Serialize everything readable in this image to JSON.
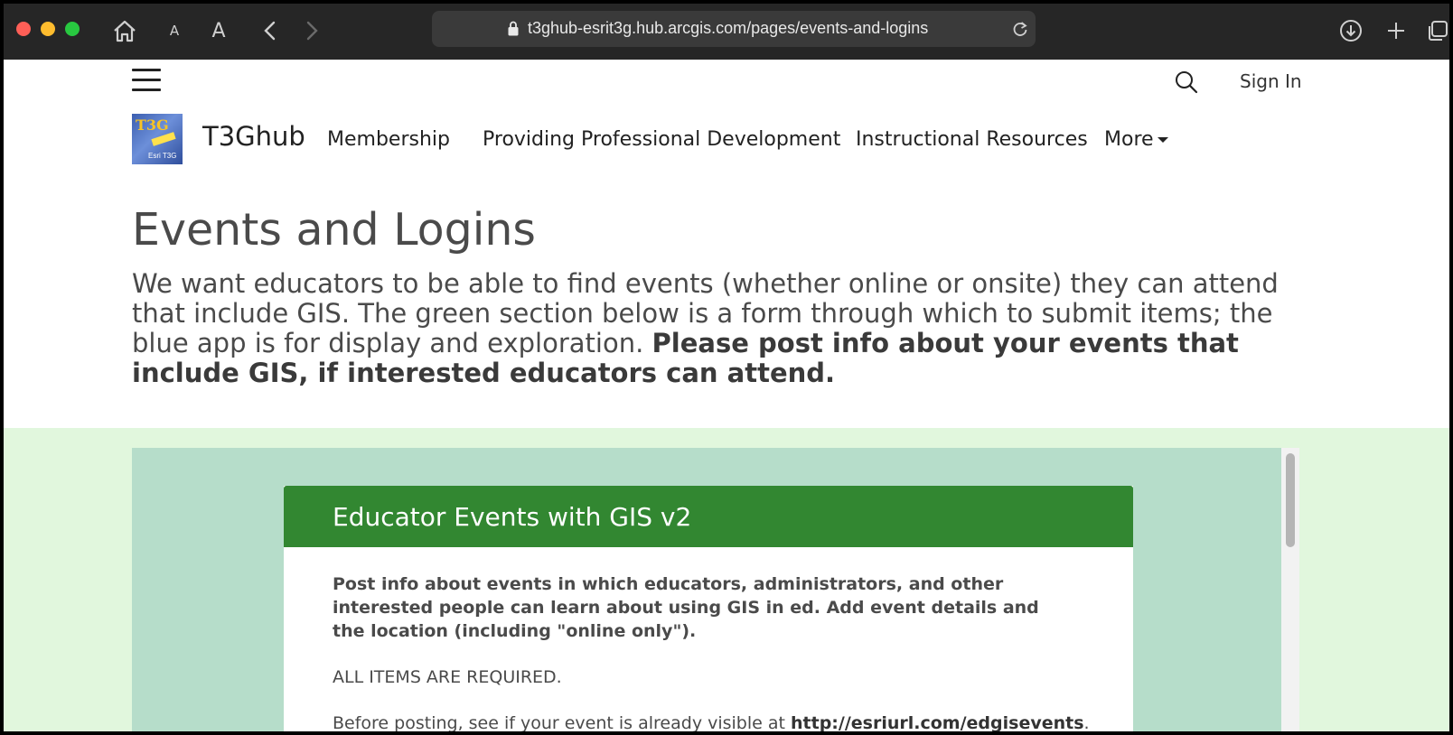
{
  "browser": {
    "url": "t3ghub-esrit3g.hub.arcgis.com/pages/events-and-logins",
    "text_small_label": "A",
    "text_large_label": "A"
  },
  "header": {
    "sign_in_label": "Sign In",
    "site_name": "T3Ghub",
    "logo_text_top": "T3G",
    "logo_text_bottom": "Esri T3G",
    "nav": [
      {
        "label": "Membership"
      },
      {
        "label": "Providing Professional Development"
      },
      {
        "label": "Instructional Resources"
      },
      {
        "label": "More"
      }
    ]
  },
  "main": {
    "title": "Events and Logins",
    "intro_plain": "We want educators to be able to find events (whether online or onsite) they can attend that include GIS. The green section below is a form through which to submit items; the blue app is for display and exploration. ",
    "intro_bold": "Please post info about your events that include GIS, if interested educators can attend."
  },
  "form": {
    "title": "Educator Events with GIS v2",
    "description_bold": "Post info about events in which educators, administrators, and other interested people can learn about using GIS in ed. Add event details and the location (including \"online only\").",
    "required_note": "ALL ITEMS ARE REQUIRED.",
    "before_text": "Before posting, see if your event is already visible at ",
    "before_link": "http://esriurl.com/edgisevents",
    "before_end": "."
  },
  "colors": {
    "form_header": "#328731",
    "green_section": "#e1f7dd",
    "embed_bg": "#b6ddca"
  }
}
